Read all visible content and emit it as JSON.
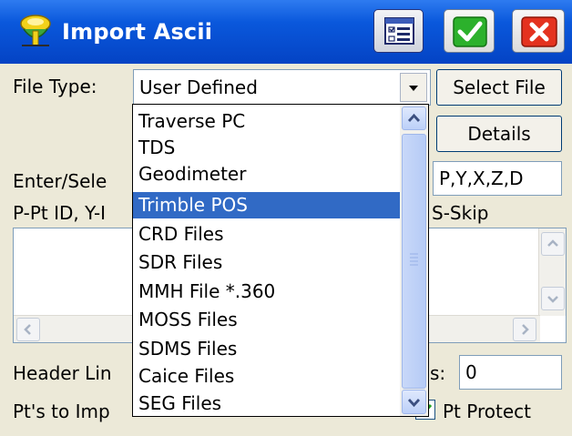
{
  "window": {
    "title": "Import Ascii"
  },
  "file_type": {
    "label": "File Type:",
    "value": "User Defined"
  },
  "buttons": {
    "select_file": "Select File",
    "details": "Details"
  },
  "enter_select": {
    "label": "Enter/Sele",
    "format_value": "P,Y,X,Z,D"
  },
  "legend": {
    "left": "P-Pt ID, Y-I",
    "right": "S-Skip"
  },
  "header_lines": {
    "label": "Header Lin",
    "label_suffix": "s:",
    "value": "0"
  },
  "pts_to_import": {
    "label": "Pt's to Imp"
  },
  "pt_protect": {
    "label": "Pt Protect",
    "checked": true
  },
  "dropdown": {
    "items": [
      "Traverse PC",
      "TDS",
      "Geodimeter",
      "Trimble POS",
      "CRD Files",
      "SDR Files",
      "MMH File *.360",
      "MOSS Files",
      "SDMS Files",
      "Caice Files",
      "SEG Files"
    ],
    "selected": "Trimble POS"
  },
  "colors": {
    "titlebar": "#0a58dc",
    "selection": "#316ac5",
    "ok_green": "#1fa11f",
    "close_red": "#e0301e"
  }
}
